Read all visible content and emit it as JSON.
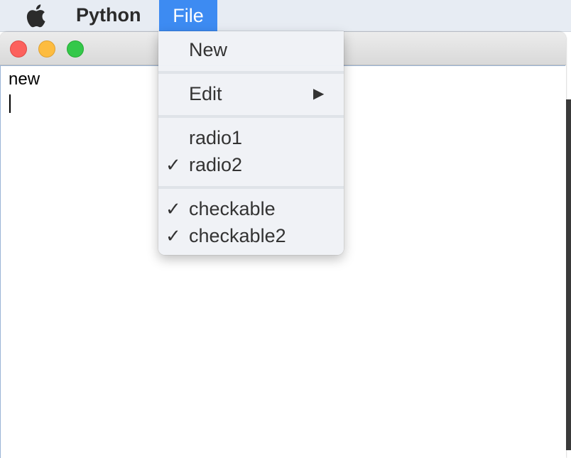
{
  "menubar": {
    "apple_icon": "apple-logo-icon",
    "app_name": "Python",
    "active_menu": "File"
  },
  "window": {
    "controls": [
      "close",
      "minimize",
      "maximize"
    ],
    "editor_text": "new"
  },
  "menu": {
    "items": [
      {
        "label": "New",
        "checked": false
      },
      {
        "label": "Edit",
        "submenu_arrow": "▶"
      },
      {
        "label": "radio1",
        "checked": false
      },
      {
        "label": "radio2",
        "checked": true,
        "check_glyph": "✓"
      },
      {
        "label": "checkable",
        "checked": true,
        "check_glyph": "✓"
      },
      {
        "label": "checkable2",
        "checked": true,
        "check_glyph": "✓"
      }
    ]
  },
  "colors": {
    "menu_highlight": "#3d8bf2",
    "menubar_bg": "#e7ecf3",
    "close": "#fc615d",
    "minimize": "#fdbc40",
    "maximize": "#34c84a"
  }
}
